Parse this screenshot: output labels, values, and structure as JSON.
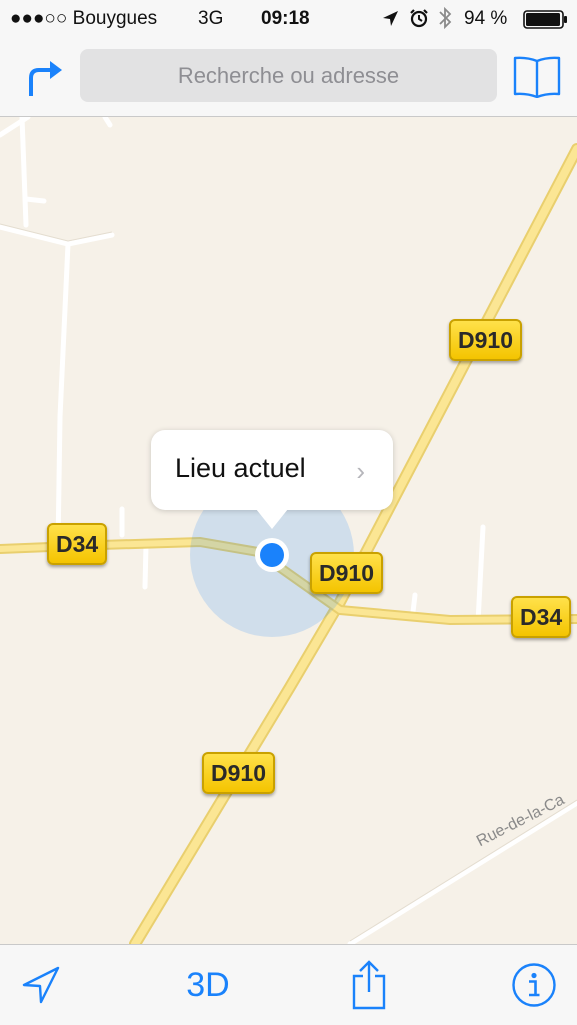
{
  "status_bar": {
    "carrier": "●●●○○ Bouygues",
    "network": "3G",
    "time": "09:18",
    "battery": "94 %"
  },
  "nav_bar": {
    "search_placeholder": "Recherche ou adresse"
  },
  "map": {
    "road_shields": [
      "D910",
      "D34",
      "D910",
      "D34",
      "D910"
    ],
    "street_label": "Rue-de-la-Ca",
    "callout": {
      "label": "Lieu actuel",
      "chevron": "›"
    }
  },
  "toolbar": {
    "three_d_label": "3D",
    "icons": [
      "location-arrow-icon",
      "share-icon",
      "info-icon"
    ]
  },
  "colors": {
    "accent": "#1a82fb",
    "map_background": "#f6f1e8",
    "road_shield": "#f8d21c",
    "location_dot": "#1a82fb"
  }
}
